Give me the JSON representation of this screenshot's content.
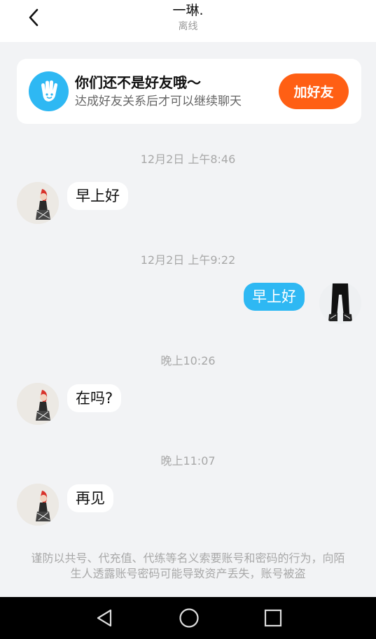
{
  "header": {
    "title": "一琳.",
    "status": "离线"
  },
  "friend_card": {
    "title": "你们还不是好友哦～",
    "subtitle": "达成好友关系后才可以继续聊天",
    "button_label": "加好友",
    "icon": "hand-wave-icon"
  },
  "messages": [
    {
      "time": "12月2日 上午8:46",
      "direction": "in",
      "text": "早上好"
    },
    {
      "time": "12月2日 上午9:22",
      "direction": "out",
      "text": "早上好"
    },
    {
      "time": "晚上10:26",
      "direction": "in",
      "text": "在吗?"
    },
    {
      "time": "晚上11:07",
      "direction": "in",
      "text": "再见"
    }
  ],
  "warning": "谨防以共号、代充值、代练等名义索要账号和密码的行为，向陌生人透露账号密码可能导致资产丢失，账号被盗",
  "colors": {
    "accent_blue": "#2eb8f3",
    "add_button": "#ff5f14",
    "background": "#f2f3f5"
  },
  "nav": {
    "icons": [
      "back-triangle-icon",
      "home-circle-icon",
      "recents-square-icon"
    ]
  }
}
